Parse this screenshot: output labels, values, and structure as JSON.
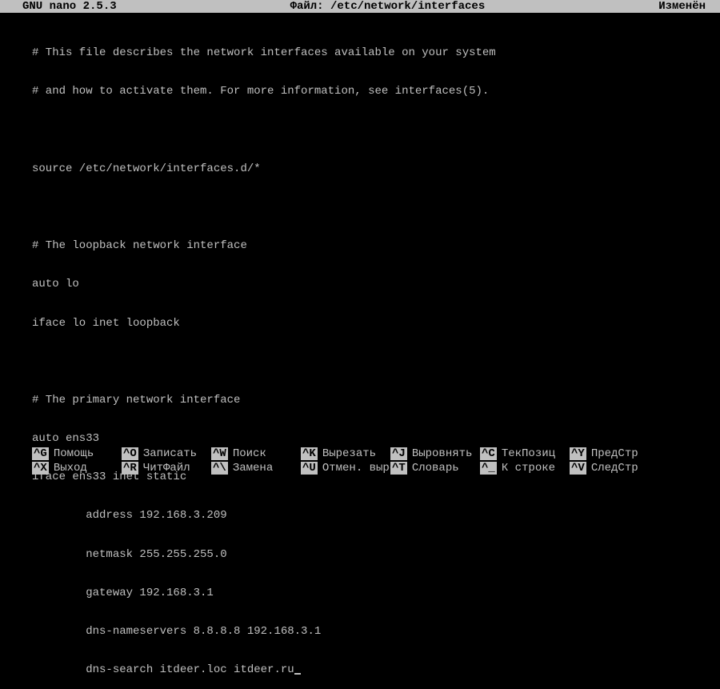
{
  "titlebar": {
    "left": "GNU nano 2.5.3",
    "center": "Файл: /etc/network/interfaces",
    "right": "Изменён"
  },
  "editor": {
    "lines": [
      "# This file describes the network interfaces available on your system",
      "# and how to activate them. For more information, see interfaces(5).",
      "",
      "source /etc/network/interfaces.d/*",
      "",
      "# The loopback network interface",
      "auto lo",
      "iface lo inet loopback",
      "",
      "# The primary network interface",
      "auto ens33",
      "iface ens33 inet static",
      "        address 192.168.3.209",
      "        netmask 255.255.255.0",
      "        gateway 192.168.3.1",
      "        dns-nameservers 8.8.8.8 192.168.3.1",
      "        dns-search itdeer.loc itdeer.ru"
    ]
  },
  "shortcuts": {
    "row1": [
      {
        "key": "^G",
        "label": "Помощь"
      },
      {
        "key": "^O",
        "label": "Записать"
      },
      {
        "key": "^W",
        "label": "Поиск"
      },
      {
        "key": "^K",
        "label": "Вырезать"
      },
      {
        "key": "^J",
        "label": "Выровнять"
      },
      {
        "key": "^C",
        "label": "ТекПозиц"
      },
      {
        "key": "^Y",
        "label": "ПредСтр"
      }
    ],
    "row2": [
      {
        "key": "^X",
        "label": "Выход"
      },
      {
        "key": "^R",
        "label": "ЧитФайл"
      },
      {
        "key": "^\\",
        "label": "Замена"
      },
      {
        "key": "^U",
        "label": "Отмен. выре"
      },
      {
        "key": "^T",
        "label": "Словарь"
      },
      {
        "key": "^_",
        "label": "К строке"
      },
      {
        "key": "^V",
        "label": "СледСтр"
      }
    ]
  }
}
